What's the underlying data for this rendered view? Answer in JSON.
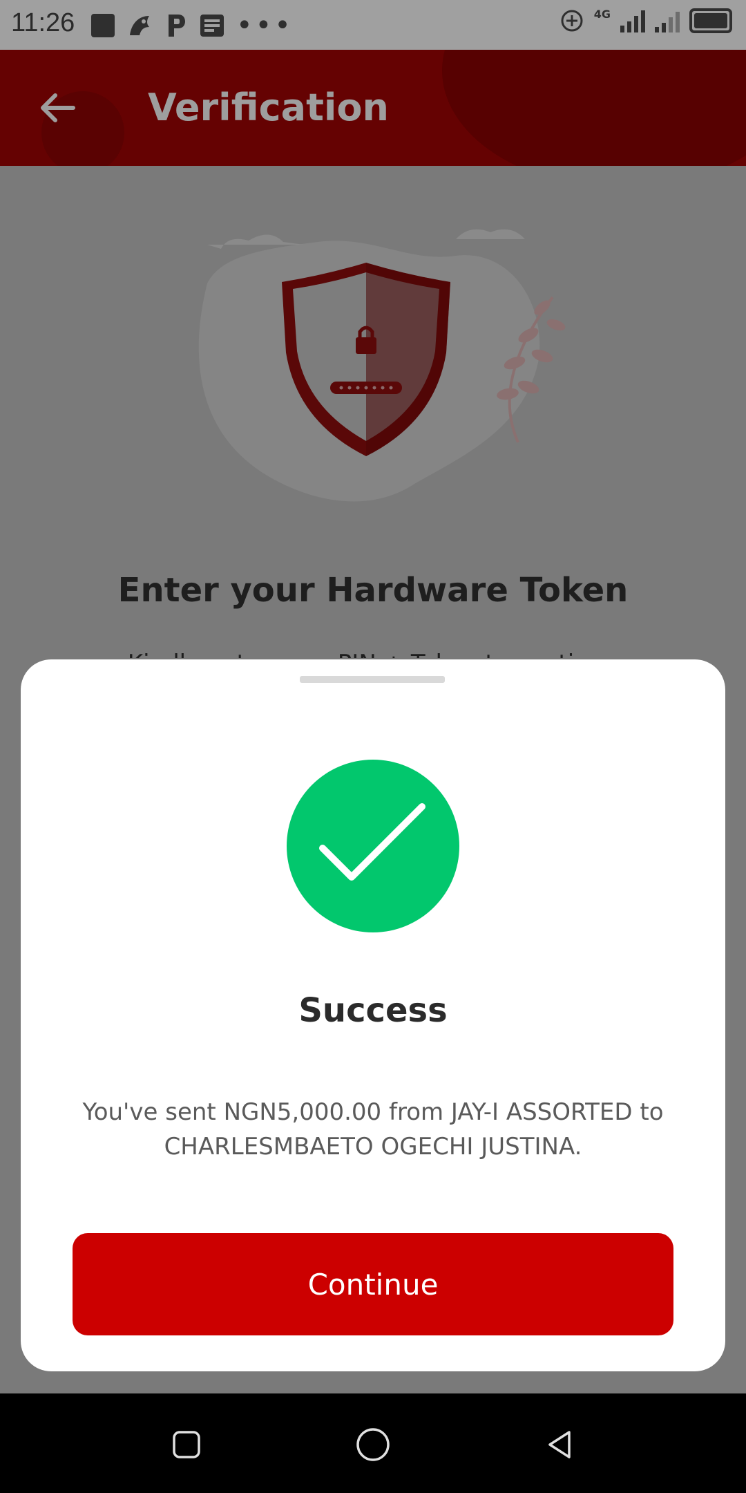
{
  "status_bar": {
    "time": "11:26",
    "network_label": "4G",
    "icons": [
      "square-app-icon",
      "bird-app-icon",
      "p-app-icon",
      "news-app-icon",
      "more-dots-icon",
      "data-saver-icon",
      "signal-icon",
      "signal-icon-2",
      "battery-icon"
    ],
    "more": "•••"
  },
  "header": {
    "title": "Verification",
    "back_icon": "arrow-left-icon",
    "color": "#650202"
  },
  "background": {
    "title": "Enter your Hardware Token",
    "subtitle": "Kindly enter your PIN + Token to continue",
    "illustration_icon": "shield-lock-icon"
  },
  "sheet": {
    "title": "Success",
    "message": "You've sent NGN5,000.00 from JAY-I ASSORTED to CHARLESMBAETO OGECHI JUSTINA.",
    "success_icon": "checkmark-icon",
    "success_color": "#02c76d",
    "button_label": "Continue",
    "button_color": "#cc0000"
  },
  "nav_bar": {
    "icons": [
      "recent-apps-icon",
      "home-icon",
      "back-triangle-icon"
    ]
  }
}
